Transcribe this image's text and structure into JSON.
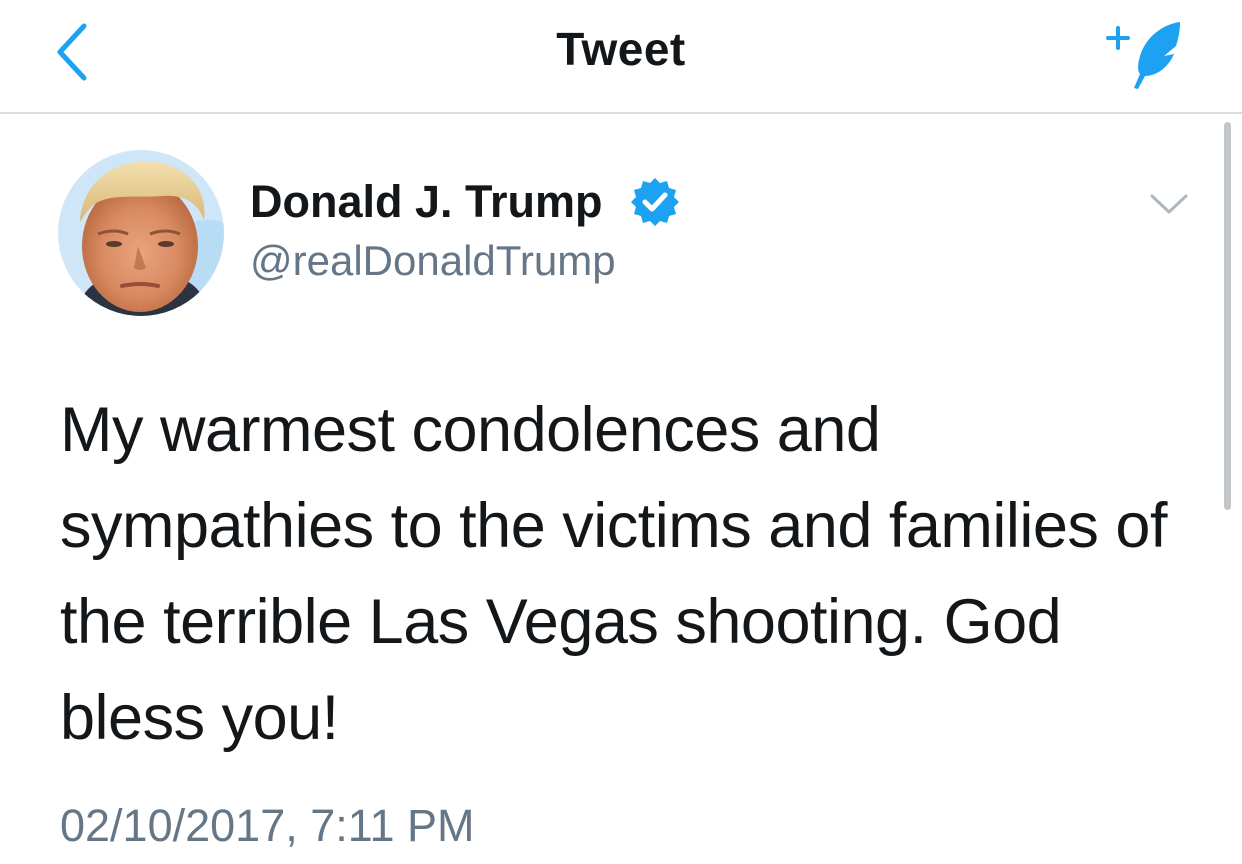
{
  "nav": {
    "title": "Tweet",
    "back_icon": "chevron-left-icon",
    "compose_icon": "compose-tweet-icon"
  },
  "tweet": {
    "author": {
      "display_name": "Donald J. Trump",
      "handle": "@realDonaldTrump",
      "verified": true,
      "avatar_icon": "profile-photo"
    },
    "text": "My warmest condolences and sympathies to the victims and families of the terrible Las Vegas shooting. God bless you!",
    "timestamp": "02/10/2017, 7:11 PM",
    "more_icon": "chevron-down-icon"
  },
  "colors": {
    "accent": "#1da1f2",
    "text_primary": "#14171a",
    "text_secondary": "#657786",
    "divider": "#d8dde1",
    "background": "#ffffff"
  }
}
